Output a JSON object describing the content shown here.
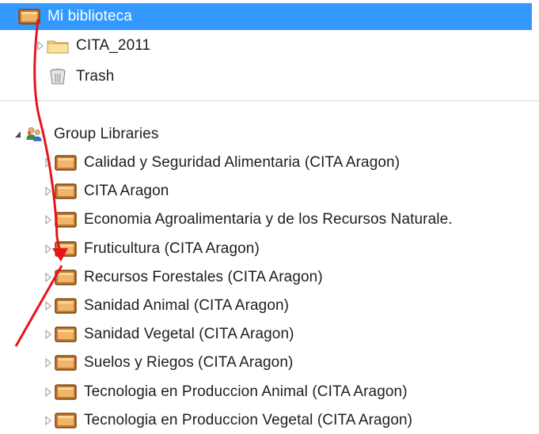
{
  "tree": {
    "root": {
      "label": "Mi biblioteca",
      "selected": true
    },
    "children": [
      {
        "label": "CITA_2011",
        "icon": "folder-icon"
      },
      {
        "label": "Trash",
        "icon": "trash-icon"
      }
    ],
    "group": {
      "label": "Group Libraries",
      "icon": "group-libraries-icon"
    },
    "group_items": [
      "Calidad y Seguridad Alimentaria (CITA Aragon)",
      "CITA Aragon",
      "Economia Agroalimentaria y de los Recursos Naturale.",
      "Fruticultura (CITA Aragon)",
      "Recursos Forestales (CITA Aragon)",
      "Sanidad Animal (CITA Aragon)",
      "Sanidad Vegetal (CITA Aragon)",
      "Suelos y Riegos (CITA Aragon)",
      "Tecnologia en Produccion Animal (CITA Aragon)",
      "Tecnologia en Produccion Vegetal (CITA Aragon)"
    ]
  },
  "colors": {
    "selection": "#3399ff",
    "annotation": "#e8141b",
    "library": "#c0772c"
  }
}
